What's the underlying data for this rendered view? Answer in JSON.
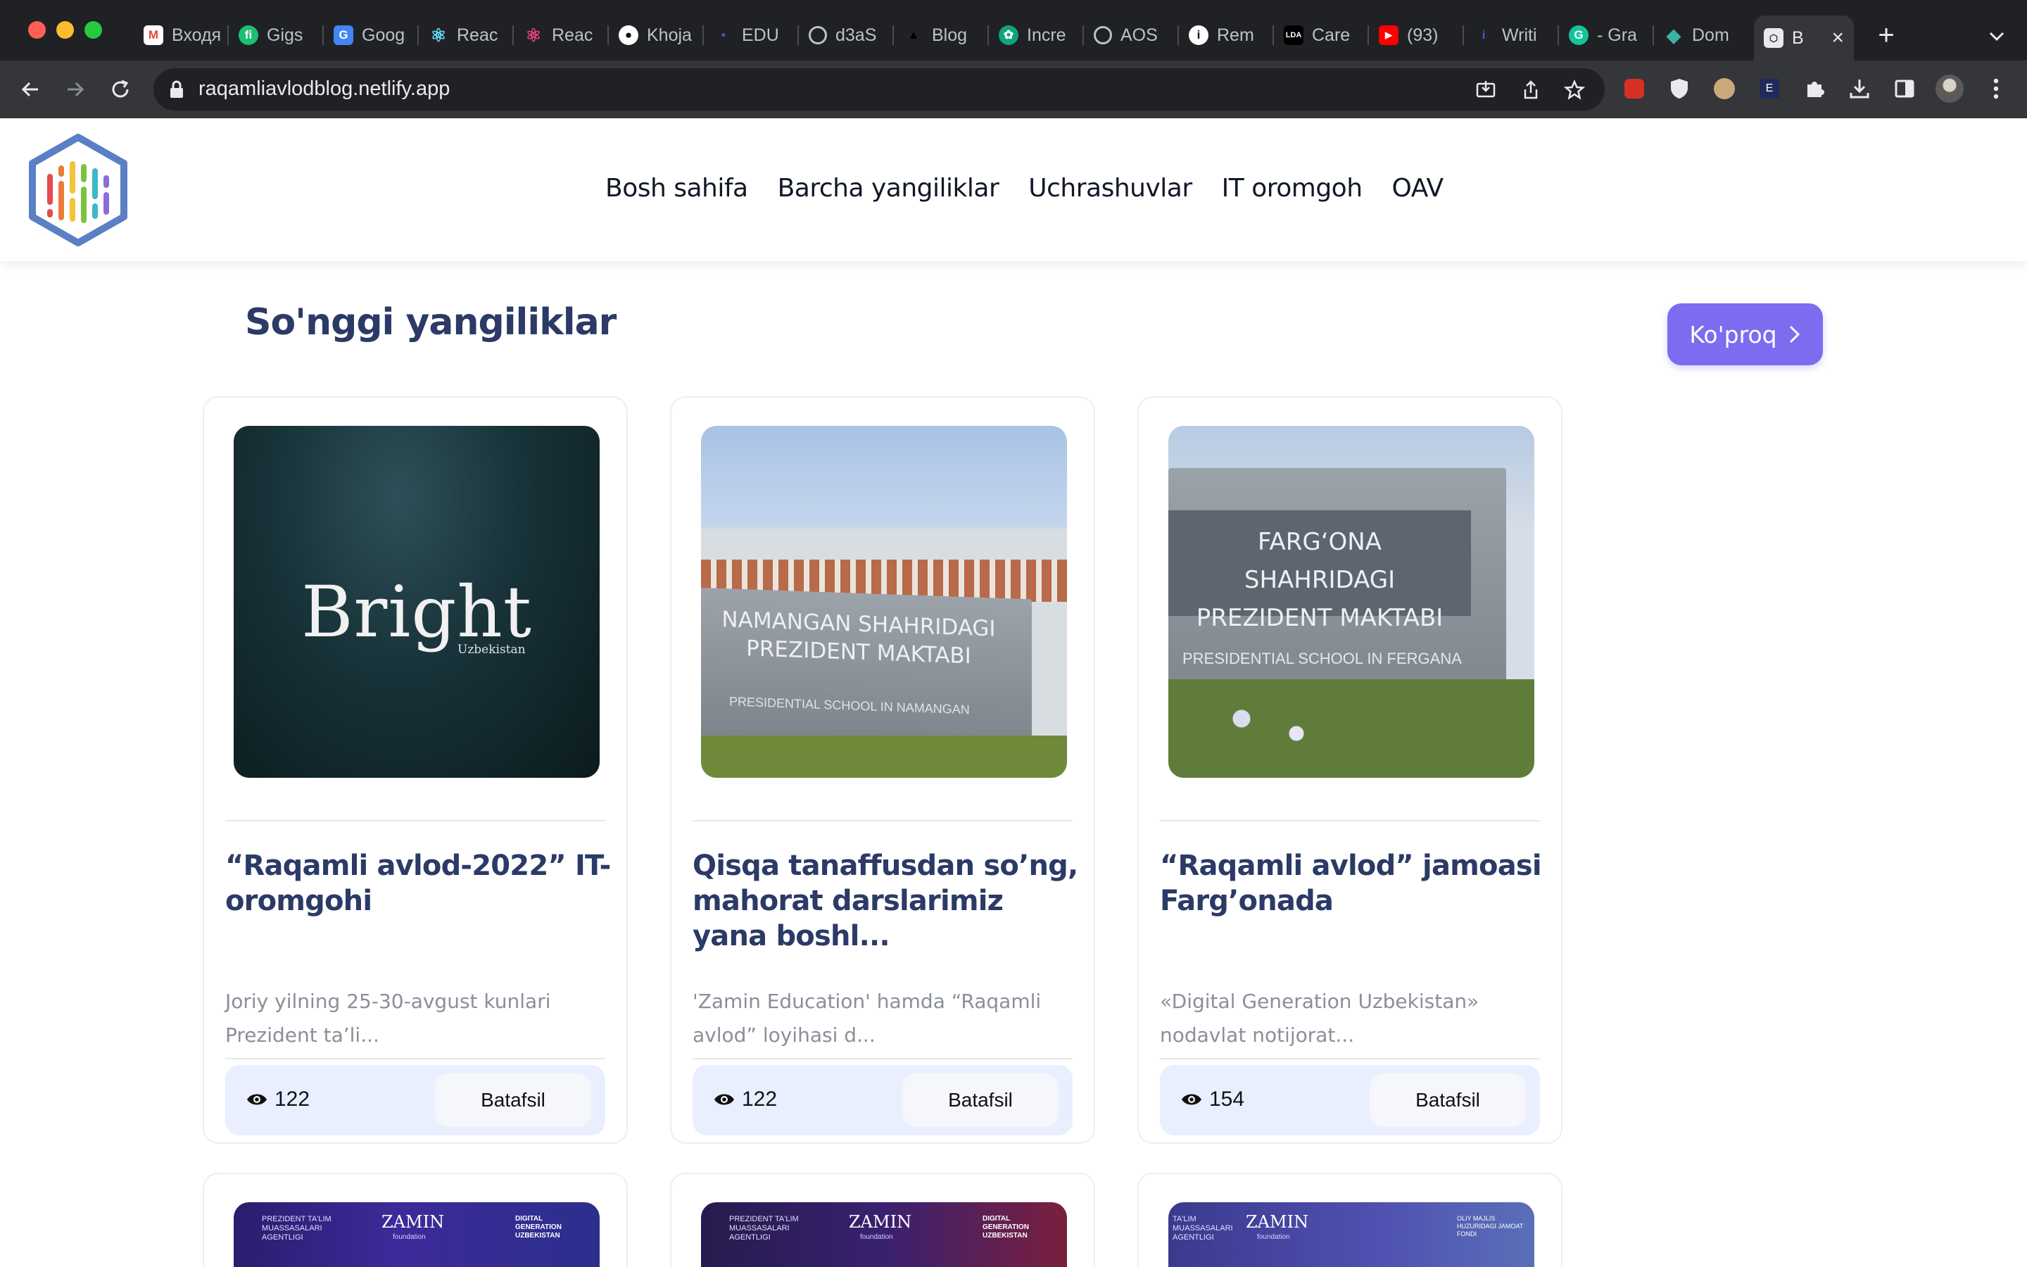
{
  "browser": {
    "tabs": [
      {
        "label": "Входя",
        "icon": "gmail-icon"
      },
      {
        "label": "Gigs",
        "icon": "fiverr-icon"
      },
      {
        "label": "Goog",
        "icon": "google-translate-icon"
      },
      {
        "label": "Reac",
        "icon": "react-icon"
      },
      {
        "label": "Reac",
        "icon": "react-icon"
      },
      {
        "label": "Khoja",
        "icon": "github-icon"
      },
      {
        "label": "EDU",
        "icon": "edu-icon"
      },
      {
        "label": "d3aS",
        "icon": "globe-icon"
      },
      {
        "label": "Blog",
        "icon": "blog-icon"
      },
      {
        "label": "Incre",
        "icon": "openai-icon"
      },
      {
        "label": "AOS",
        "icon": "globe-icon"
      },
      {
        "label": "Rem",
        "icon": "info-icon"
      },
      {
        "label": "Care",
        "icon": "lda-icon"
      },
      {
        "label": "(93)",
        "icon": "youtube-icon"
      },
      {
        "label": "Writi",
        "icon": "writing-icon"
      },
      {
        "label": "- Gra",
        "icon": "grammarly-icon"
      },
      {
        "label": "Dom",
        "icon": "domain-icon"
      },
      {
        "label": "B",
        "icon": "site-favicon"
      }
    ],
    "url": "raqamliavlodblog.netlify.app"
  },
  "header": {
    "nav": [
      "Bosh sahifa",
      "Barcha yangiliklar",
      "Uchrashuvlar",
      "IT oromgoh",
      "OAV"
    ]
  },
  "main": {
    "section_title": "So'nggi yangiliklar",
    "more_label": "Ko'proq",
    "cards": [
      {
        "image_text": "Bright",
        "image_subtext": "Uzbekistan",
        "title": "“Raqamli avlod-2022” IT-oromgohi",
        "desc": "Joriy yilning 25-30-avgust kunlari Prezident ta’li...",
        "views": "122",
        "button": "Batafsil"
      },
      {
        "image_text": "NAMANGAN SHAHRIDAGI PREZIDENT MAKTABI",
        "image_subtext": "PRESIDENTIAL SCHOOL IN NAMANGAN",
        "title": "Qisqa tanaffusdan so’ng, mahorat darslarimiz yana boshl...",
        "desc": "'Zamin Education' hamda “Raqamli avlod” loyihasi d...",
        "views": "122",
        "button": "Batafsil"
      },
      {
        "image_text": "FARG‘ONA SHAHRIDAGI PREZIDENT MAKTABI",
        "image_subtext": "PRESIDENTIAL SCHOOL IN FERGANA",
        "title": "“Raqamli avlod” jamoasi Farg’onada",
        "desc": "«Digital Generation Uzbekistan» nodavlat notijorat...",
        "views": "154",
        "button": "Batafsil"
      }
    ],
    "banners": [
      {
        "left": "PREZIDENT TA'LIM MUASSASALARI AGENTLIGI",
        "center": "ZAMIN",
        "center_sub": "foundation",
        "right": "DIGITAL GENERATION UZBEKISTAN"
      },
      {
        "left": "PREZIDENT TA'LIM MUASSASALARI AGENTLIGI",
        "center": "ZAMIN",
        "center_sub": "foundation",
        "right": "DIGITAL GENERATION UZBEKISTAN"
      },
      {
        "left": "TA'LIM MUASSASALARI AGENTLIGI",
        "center": "ZAMIN",
        "center_sub": "foundation",
        "right": "OLIY MAJLIS HUZURIDAGI JAMOAT FONDI"
      }
    ]
  }
}
